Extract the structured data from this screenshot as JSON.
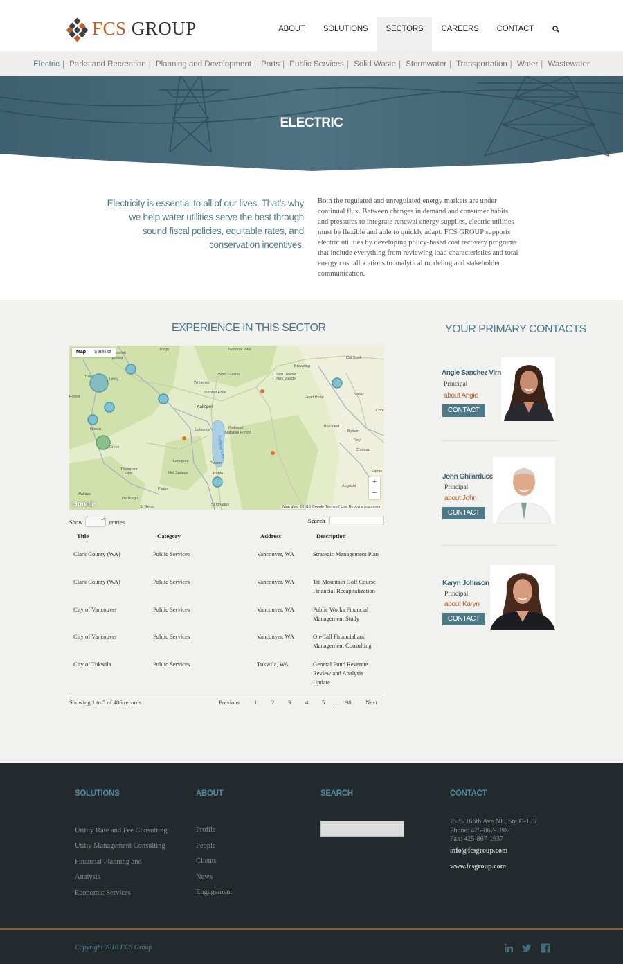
{
  "brand": {
    "name_accent": "FCS",
    "name_rest": " GROUP"
  },
  "nav": {
    "items": [
      "ABOUT",
      "SOLUTIONS",
      "SECTORS",
      "CAREERS",
      "CONTACT"
    ],
    "active": "SECTORS"
  },
  "subnav": [
    "Electric",
    "Parks and Recreation",
    "Planning and Development",
    "Ports",
    "Public Services",
    "Solid Waste",
    "Stormwater",
    "Transportation",
    "Water",
    "Wastewater"
  ],
  "hero": {
    "title": "ELECTRIC"
  },
  "intro": {
    "quote": "Electricity is essential to all of our lives. That’s why we help water utilities serve the best through sound fiscal policies, equitable rates, and conservation incentives.",
    "body": "Both the regulated and unregulated energy markets are under continual flux. Between changes in demand and consumer habits, and pressures to integrate renewal energy supplies, electric utilities must be flexible and able to quickly adapt. FCS GROUP supports electric utilities by developing policy-based cost recovery programs that include everything from reviewing load characteristics and total energy cost allocations to analytical modeling and stakeholder communication."
  },
  "experience": {
    "title": "EXPERIENCE IN THIS SECTOR",
    "map": {
      "tabs": [
        "Map",
        "Satellite"
      ],
      "zoom_in": "+",
      "zoom_out": "−",
      "google": "Google",
      "attribution": "Map data ©2016 Google   Terms of Use   Report a map error",
      "places": [
        "National Park",
        "Trego",
        "Cut Bank",
        "Browning",
        "East Glacier Park Village",
        "West Glacier",
        "Whitefish",
        "Columbia Falls",
        "Kalispell",
        "Flathead National Forest",
        "Heart Butte",
        "Valier",
        "Blackleaf",
        "Bynum",
        "Choteau",
        "Augusta",
        "Lakeside",
        "Polson",
        "Pablo",
        "St Ignatius",
        "St Regis",
        "De Borgia",
        "Wallace",
        "Plains",
        "Hot Springs",
        "Lonepine",
        "Thompson Falls",
        "Noxon",
        "Libby",
        "Troy",
        "Forest",
        "Creek",
        "Flathead Lake",
        "Kootenai Forest",
        "Fairfie",
        "Conr"
      ]
    },
    "table": {
      "show_label": "Show",
      "entries_label": "entries",
      "search_label": "Search",
      "columns": [
        "Title",
        "Category",
        "Address",
        "Description"
      ],
      "rows": [
        [
          "Clark County (WA)",
          "Public Services",
          "Vancouver, WA",
          "Strategic Management Plan"
        ],
        [
          "Clark County (WA)",
          "Public Services",
          "Vancouver, WA",
          "Tri-Mountain Golf Course Financial Recapitalization"
        ],
        [
          "City of Vancouver",
          "Public Services",
          "Vancouver, WA",
          "Public Works Financial Management Study"
        ],
        [
          "City of Vancouver",
          "Public Services",
          "Vancouver, WA",
          "On-Call Financial and Management Consulting"
        ],
        [
          "City of Tukwila",
          "Public Services",
          "Tukwila, WA",
          "General Fund Revenue Review and Analysis Update"
        ]
      ],
      "info": "Showing 1 to 5 of 486 records",
      "pager": {
        "previous": "Previous",
        "pages": [
          "1",
          "2",
          "3",
          "4",
          "5"
        ],
        "ellipsis": "…",
        "last": "98",
        "next": "Next"
      }
    }
  },
  "contacts": {
    "title": "YOUR PRIMARY CONTACTS",
    "people": [
      {
        "name": "Angie Sanchez Virnoche",
        "role": "Principal",
        "about": "about Angie",
        "button": "CONTACT"
      },
      {
        "name": "John Ghilarducci",
        "role": "Principal",
        "about": "about John",
        "button": "CONTACT"
      },
      {
        "name": "Karyn Johnson",
        "role": "Principal",
        "about": "about Karyn",
        "button": "CONTACT"
      }
    ]
  },
  "footer": {
    "solutions": {
      "title": "SOLUTIONS",
      "links": [
        "Utility Rate and Fee Consulting",
        "Utiliy Management Consulting",
        "Financial Planning and",
        "Analysis",
        "Economic Services"
      ]
    },
    "about": {
      "title": "ABOUT",
      "links": [
        "Profile",
        "People",
        "Clients",
        "News",
        "Engagement"
      ]
    },
    "search": {
      "title": "SEARCH"
    },
    "contact": {
      "title": "CONTACT",
      "address": [
        "7525 166th Ave NE, Ste D-125",
        "Phone: 425-867-1802",
        "Fax: 425-867-1937"
      ],
      "email": "info@fcsgroup.com",
      "web": "www.fcsgroup.com"
    },
    "copyright": "Copyright 2016 FCS Group",
    "social": [
      "linkedin-icon",
      "twitter-icon",
      "facebook-icon"
    ]
  },
  "colors": {
    "accent": "#4d7a86",
    "brand_orange": "#b8612a",
    "footer_bg": "#232a2d"
  }
}
